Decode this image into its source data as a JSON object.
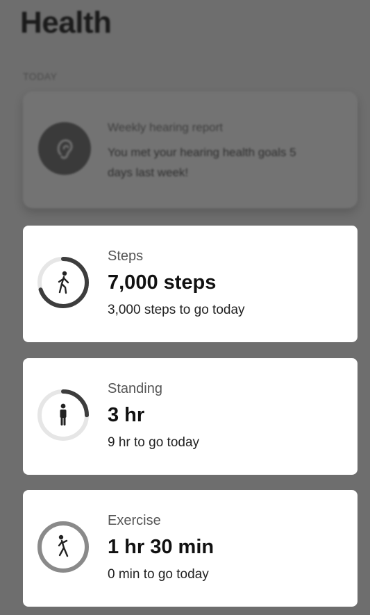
{
  "header": {
    "title": "Health"
  },
  "section_label": "TODAY",
  "hearing_card": {
    "title": "Weekly hearing report",
    "body": "You met your hearing health goals 5 days last week!",
    "icon": "ear-icon"
  },
  "metrics": [
    {
      "label": "Steps",
      "value": "7,000 steps",
      "subtext": "3,000 steps to go today",
      "progress": 0.7,
      "icon": "walking-icon"
    },
    {
      "label": "Standing",
      "value": "3 hr",
      "subtext": "9 hr to go today",
      "progress": 0.25,
      "icon": "standing-person-icon"
    },
    {
      "label": "Exercise",
      "value": "1 hr 30 min",
      "subtext": "0 min to go today",
      "progress": 1.0,
      "icon": "exercise-icon"
    }
  ],
  "colors": {
    "overlay": "#6e6e6e",
    "card": "#ffffff",
    "ring_track": "#e6e6e6",
    "ring_progress": "#3d3d3d",
    "ring_complete": "#8a8a8a"
  }
}
